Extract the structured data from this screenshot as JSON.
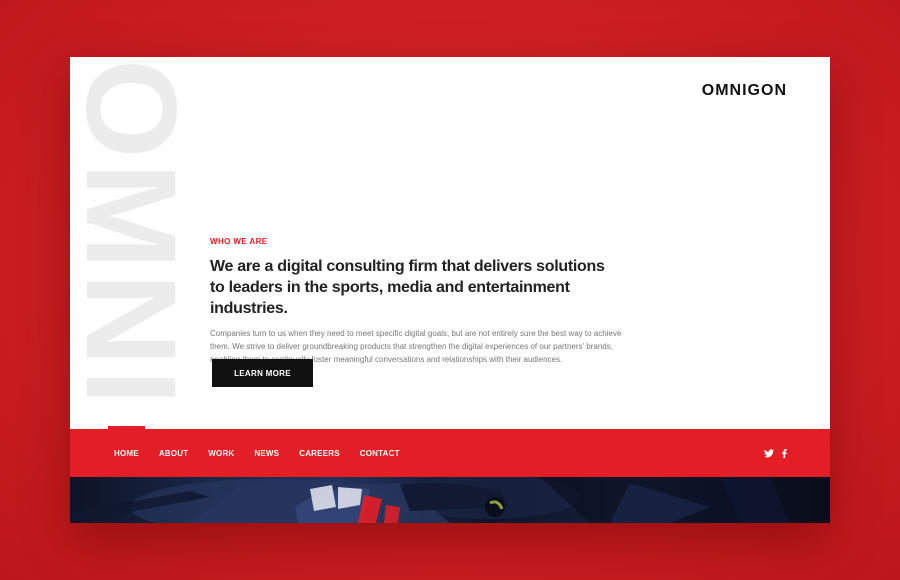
{
  "header": {
    "logo": "OMNIGON",
    "watermark": "OMNI"
  },
  "intro": {
    "eyebrow": "WHO WE ARE",
    "headline_line1": "We are a digital consulting firm that delivers solutions",
    "headline_line2": "to leaders in the sports, media and entertainment industries.",
    "body_line1": "Companies turn to us when they need to meet specific digital goals, but are not entirely sure the best way to achieve",
    "body_line2": "them. We strive to deliver groundbreaking products that strengthen the digital experiences of our partners' brands,",
    "body_line3": "enabling them to continually foster meaningful conversations and relationships with their audiences.",
    "cta_label": "LEARN MORE"
  },
  "nav": {
    "items": [
      {
        "label": "HOME"
      },
      {
        "label": "ABOUT"
      },
      {
        "label": "WORK"
      },
      {
        "label": "NEWS"
      },
      {
        "label": "CAREERS"
      },
      {
        "label": "CONTACT"
      }
    ],
    "active": "HOME",
    "social": [
      {
        "icon": "twitter-icon"
      },
      {
        "icon": "facebook-icon"
      }
    ]
  },
  "colors": {
    "brand_red": "#e41e26",
    "page_background": "#d02024",
    "text_dark": "#222222",
    "button_black": "#111111"
  }
}
